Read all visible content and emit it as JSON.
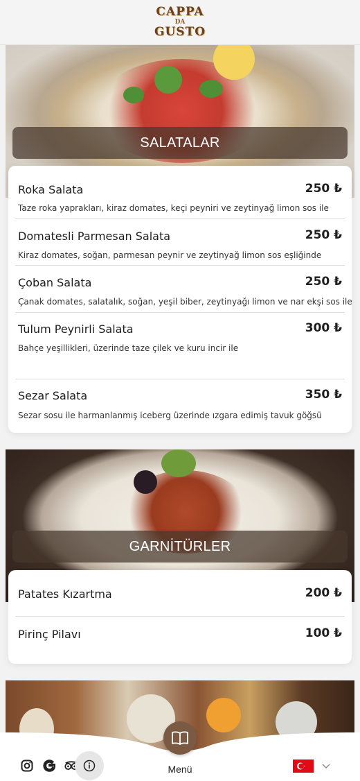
{
  "brand": {
    "line1": "CAPPA",
    "mid": "DA",
    "line2": "GUSTO"
  },
  "categories": [
    {
      "title": "SALATALAR",
      "items": [
        {
          "name": "Roka Salata",
          "price": "250 ₺",
          "desc": "Taze roka yaprakları, kiraz domates, keçi peyniri ve zeytinyağ limon sos ile"
        },
        {
          "name": "Domatesli Parmesan Salata",
          "price": "250 ₺",
          "desc": "Kiraz domates, soğan, parmesan peynir ve zeytinyağ limon sos eşliğinde"
        },
        {
          "name": "Çoban Salata",
          "price": "250 ₺",
          "desc": "Çanak domates, salatalık, soğan, yeşil biber, zeytinyağı limon ve nar ekşi sos ile"
        },
        {
          "name": "Tulum Peynirli Salata",
          "price": "300 ₺",
          "desc": "Bahçe yeşillikleri, üzerinde taze çilek ve kuru incir ile"
        },
        {
          "name": "Sezar Salata",
          "price": "350 ₺",
          "desc": "Sezar sosu ile harmanlanmış iceberg üzerinde ızgara edimiş tavuk göğsü"
        }
      ]
    },
    {
      "title": "GARNİTÜRLER",
      "items": [
        {
          "name": "Patates Kızartma",
          "price": "200 ₺"
        },
        {
          "name": "Pirinç Pilavı",
          "price": "100 ₺"
        }
      ]
    }
  ],
  "bottom_bar": {
    "menu_label": "Menü",
    "icons": [
      "instagram-icon",
      "google-icon",
      "tripadvisor-icon",
      "info-icon",
      "menu-book-icon"
    ],
    "language": "turkish-flag",
    "colors": {
      "menu_button": "#7a5a42",
      "flag": "#e30a17"
    }
  }
}
